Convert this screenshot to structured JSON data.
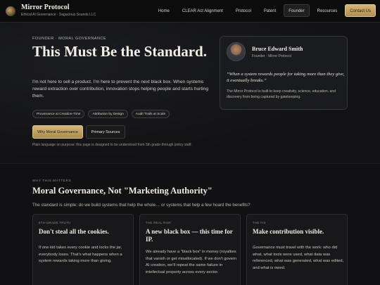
{
  "header": {
    "brand_name": "Mirror Protocol",
    "brand_sub": "Ethical AI Governance · Sagacious Sounds LLC",
    "nav": [
      "Home",
      "CLEAR Act Alignment",
      "Protocol",
      "Patent",
      "Founder",
      "Resources"
    ],
    "active_nav": "Founder",
    "contact_label": "Contact Us"
  },
  "hero": {
    "eyebrow": "FOUNDER · MORAL GOVERNANCE",
    "title": "This Must Be the Standard.",
    "body": "I'm not here to sell a product. I'm here to prevent the next black box. When systems reward extraction over contribution, innovation stops helping people and starts hurting them.",
    "tags": [
      "Provenance at Creation-Time",
      "Attribution by Design",
      "Audit Trails at Scale"
    ],
    "primary_button": "Why Moral Governance",
    "secondary_button": "Primary Sources",
    "note": "Plain language on purpose: this page is designed to be understood from 5th grade through policy staff."
  },
  "founder_card": {
    "name": "Bruce Edward Smith",
    "role": "Founder · Mirror Protocol",
    "quote": "“When a system rewards people for taking more than they give, it eventually breaks.”",
    "text": "The Mirror Protocol is built to keep creativity, science, education, and discovery from being captured by gatekeeping."
  },
  "why": {
    "eyebrow": "WHY THIS MATTERS",
    "title": "Moral Governance, Not \"Marketing Authority\"",
    "subtitle": "The standard is simple: do we build systems that help the whole… or systems that help a few hoard the benefits?",
    "cards": [
      {
        "eyebrow": "5TH-GRADE TRUTH",
        "title": "Don't steal all the cookies.",
        "body": "If one kid takes every cookie and locks the jar, everybody loses. That's what happens when a system rewards taking more than giving."
      },
      {
        "eyebrow": "THE REAL RISK",
        "title": "A new black box — this time for IP.",
        "body": "We already have a \"black box\" in money (royalties that vanish or get misallocated). If we don't govern AI creation, we'll repeat the same failure in intellectual property across every sector."
      },
      {
        "eyebrow": "THE FIX",
        "title": "Make contribution visible.",
        "body": "Governance must travel with the work: who did what, what tools were used, what data was referenced, what was generated, what was edited, and what is owed."
      }
    ]
  },
  "icons": [
    "mirror-logo-icon",
    "founder-portrait"
  ]
}
